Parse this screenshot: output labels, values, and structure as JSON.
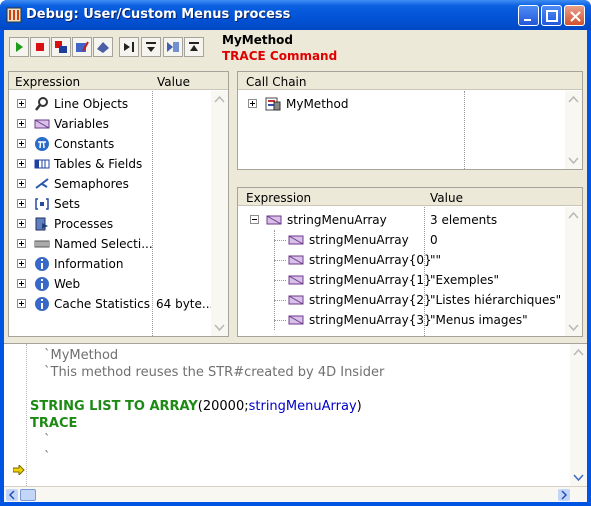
{
  "window": {
    "title": "Debug: User/Custom Menus process",
    "icon": "4d-debug-icon"
  },
  "header": {
    "method": "MyMethod",
    "trace_label": "TRACE Command",
    "trace_color": "#e00000"
  },
  "toolbar": {
    "buttons": [
      "run-icon",
      "abort-icon",
      "abort-and-edit-icon",
      "edit-icon",
      "save-settings-icon",
      "step-over-icon",
      "step-into-icon",
      "call-chain-icon",
      "step-out-icon"
    ]
  },
  "expression_pane": {
    "col_expression": "Expression",
    "col_value": "Value",
    "items": [
      {
        "label": "Line Objects",
        "value": "",
        "icon": "magnifier-icon"
      },
      {
        "label": "Variables",
        "value": "",
        "icon": "variable-icon"
      },
      {
        "label": "Constants",
        "value": "",
        "icon": "pi-icon"
      },
      {
        "label": "Tables & Fields",
        "value": "",
        "icon": "table-icon"
      },
      {
        "label": "Semaphores",
        "value": "",
        "icon": "semaphore-icon"
      },
      {
        "label": "Sets",
        "value": "",
        "icon": "set-icon"
      },
      {
        "label": "Processes",
        "value": "",
        "icon": "process-icon"
      },
      {
        "label": "Named Selecti...",
        "value": "",
        "icon": "selection-icon"
      },
      {
        "label": "Information",
        "value": "",
        "icon": "info-icon"
      },
      {
        "label": "Web",
        "value": "",
        "icon": "info-icon"
      },
      {
        "label": "Cache Statistics",
        "value": "64 byte...",
        "icon": "info-icon"
      }
    ]
  },
  "call_chain": {
    "header": "Call Chain",
    "items": [
      {
        "label": "MyMethod",
        "icon": "method-icon"
      }
    ]
  },
  "watch_pane": {
    "col_expression": "Expression",
    "col_value": "Value",
    "root": {
      "label": "stringMenuArray",
      "value": "3 elements"
    },
    "children": [
      {
        "label": "stringMenuArray",
        "value": "0"
      },
      {
        "label": "stringMenuArray{0}",
        "value": "\"\""
      },
      {
        "label": "stringMenuArray{1}",
        "value": "\"Exemples\""
      },
      {
        "label": "stringMenuArray{2}",
        "value": "\"Listes hiérarchiques\""
      },
      {
        "label": "stringMenuArray{3}",
        "value": "\"Menus images\""
      }
    ]
  },
  "code": {
    "comment1": "`MyMethod",
    "comment2": "`This method reuses the STR#created by 4D Insider",
    "line3_cmd": "STRING LIST TO ARRAY",
    "line3_args_open": "(20000;",
    "line3_var": "stringMenuArray",
    "line3_close": ")",
    "line4_cmd": "TRACE",
    "blank1": "`",
    "blank2": "`",
    "colors": {
      "command": "#1d8a14",
      "variable": "#0000c8",
      "comment": "#707070"
    }
  }
}
